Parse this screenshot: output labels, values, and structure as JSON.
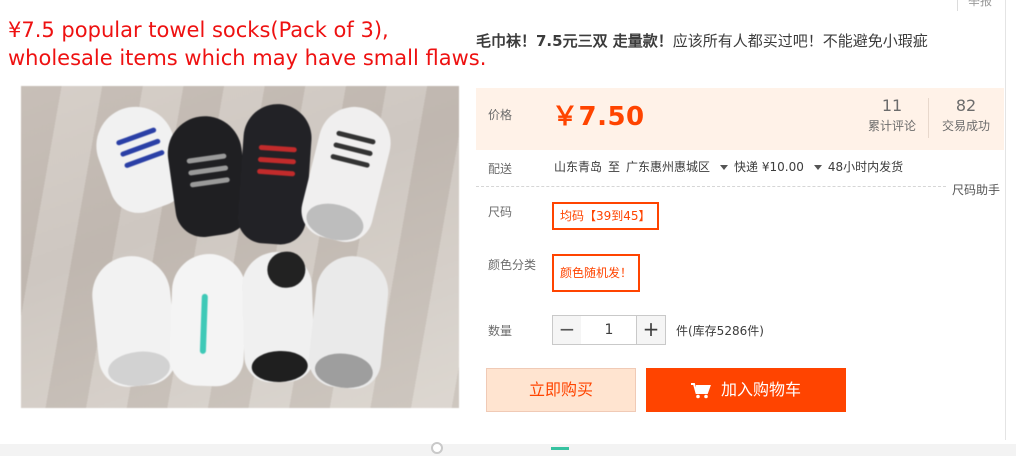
{
  "annotation": {
    "line1": "¥7.5 popular towel socks(Pack of 3),",
    "line2": "wholesale items which may have small flaws."
  },
  "header": {
    "report_label": "举报"
  },
  "product": {
    "title_bold": "毛巾袜！7.5元三双 走量款！",
    "title_rest": "应该所有人都买过吧！不能避免小瑕疵"
  },
  "price": {
    "label": "价格",
    "value": "￥7.50",
    "reviews_count": "11",
    "reviews_label": "累计评论",
    "sales_count": "82",
    "sales_label": "交易成功"
  },
  "shipping": {
    "label": "配送",
    "from": "山东青岛",
    "to_word": "至",
    "destination": "广东惠州惠城区",
    "method": "快递 ¥10.00",
    "dispatch": "48小时内发货",
    "size_help": "尺码助手"
  },
  "options": {
    "size_label": "尺码",
    "size_value": "均码【39到45】",
    "color_label": "颜色分类",
    "color_value": "颜色随机发！"
  },
  "quantity": {
    "label": "数量",
    "minus": "−",
    "value": "1",
    "plus": "+",
    "stock": "件(库存5286件)"
  },
  "actions": {
    "buy_now": "立即购买",
    "add_to_cart": "加入购物车"
  },
  "colors": {
    "accent": "#ff4400",
    "price_bg": "#fff2e8",
    "annotation": "#ee1111"
  },
  "icons": {
    "cart": "cart-icon",
    "dropdown": "triangle-down-icon"
  }
}
